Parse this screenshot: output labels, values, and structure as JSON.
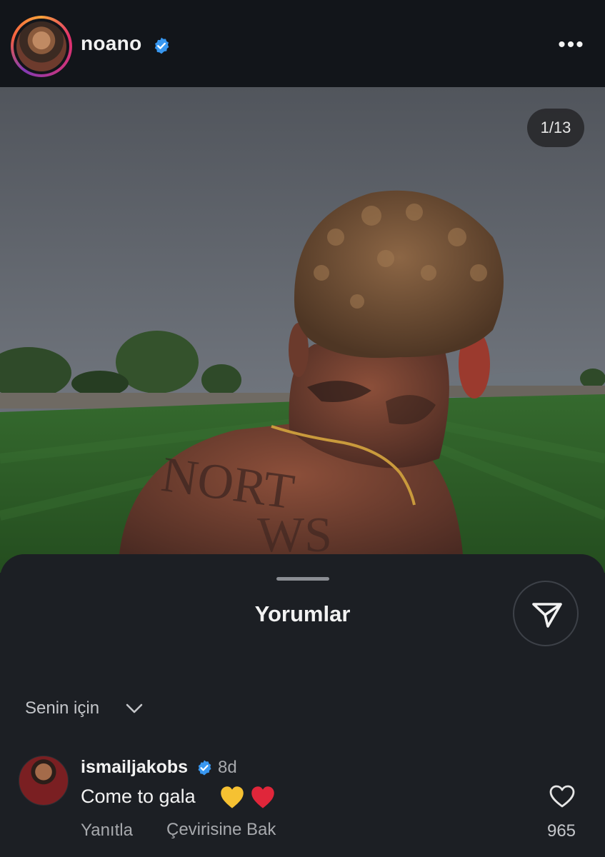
{
  "post": {
    "username": "noano",
    "verified": true,
    "more_icon": "more-dots-icon",
    "image_counter": "1/13"
  },
  "comments_sheet": {
    "title": "Yorumlar",
    "share_icon": "send-icon",
    "filter_label": "Senin için",
    "filter_icon": "chevron-down-icon"
  },
  "comments": [
    {
      "username": "ismailjakobs",
      "verified": true,
      "time": "8d",
      "text": "Come to gala",
      "emojis": [
        "yellow-heart",
        "red-heart"
      ],
      "reply_label": "Yanıtla",
      "translate_label": "Çevirisine Bak",
      "like_count": "965"
    }
  ],
  "colors": {
    "verified_blue": "#3897f0",
    "background": "#1c1f24",
    "header": "#12151a"
  }
}
